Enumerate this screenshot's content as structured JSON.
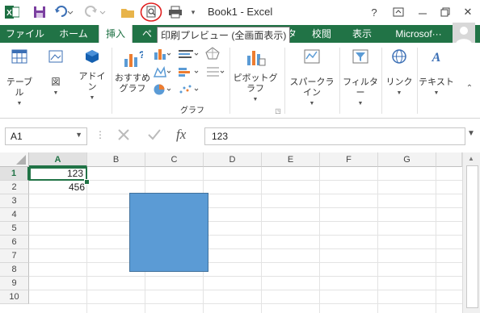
{
  "window": {
    "title": "Book1 - Excel"
  },
  "quick_access": {
    "excel_icon_label": "X"
  },
  "tabs": [
    "ファイル",
    "ホーム",
    "挿入",
    "ペ",
    "ータ",
    "校閲",
    "表示",
    "Microsof···"
  ],
  "active_tab": "挿入",
  "tooltip": "印刷プレビュー (全画面表示)",
  "ribbon": {
    "table_label": "テーブル",
    "illustrations_label": "図",
    "addins_label_1": "アドイ",
    "addins_label_2": "ン",
    "recommended_1": "おすすめ",
    "recommended_2": "グラフ",
    "charts_group_label": "グラフ",
    "pivot_chart_label": "ピボットグラフ",
    "sparkline_label": "スパークライン",
    "filter_label": "フィルター",
    "link_label": "リンク",
    "text_label": "テキスト"
  },
  "formula_bar": {
    "name_box": "A1",
    "fx_label": "fx",
    "value": "123"
  },
  "grid": {
    "columns": [
      "A",
      "B",
      "C",
      "D",
      "E",
      "F",
      "G"
    ],
    "rows": [
      "1",
      "2",
      "3",
      "4",
      "5",
      "6",
      "7",
      "8",
      "9",
      "10"
    ],
    "cells": {
      "A1": "123",
      "A2": "456"
    }
  },
  "colors": {
    "accent": "#217346",
    "shape_fill": "#5b9bd5",
    "highlight_circle": "#e02020"
  }
}
